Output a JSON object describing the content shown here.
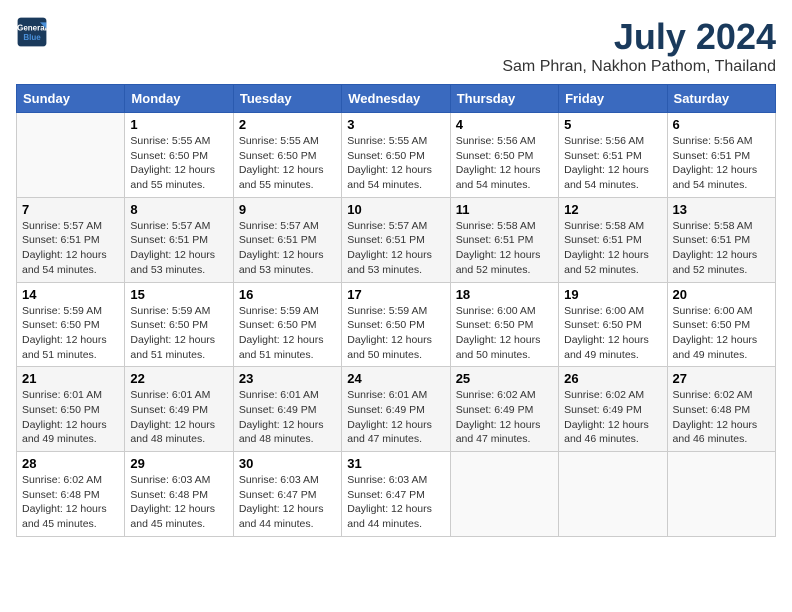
{
  "header": {
    "logo_line1": "General",
    "logo_line2": "Blue",
    "month": "July 2024",
    "location": "Sam Phran, Nakhon Pathom, Thailand"
  },
  "weekdays": [
    "Sunday",
    "Monday",
    "Tuesday",
    "Wednesday",
    "Thursday",
    "Friday",
    "Saturday"
  ],
  "weeks": [
    [
      {
        "day": "",
        "info": ""
      },
      {
        "day": "1",
        "info": "Sunrise: 5:55 AM\nSunset: 6:50 PM\nDaylight: 12 hours\nand 55 minutes."
      },
      {
        "day": "2",
        "info": "Sunrise: 5:55 AM\nSunset: 6:50 PM\nDaylight: 12 hours\nand 55 minutes."
      },
      {
        "day": "3",
        "info": "Sunrise: 5:55 AM\nSunset: 6:50 PM\nDaylight: 12 hours\nand 54 minutes."
      },
      {
        "day": "4",
        "info": "Sunrise: 5:56 AM\nSunset: 6:50 PM\nDaylight: 12 hours\nand 54 minutes."
      },
      {
        "day": "5",
        "info": "Sunrise: 5:56 AM\nSunset: 6:51 PM\nDaylight: 12 hours\nand 54 minutes."
      },
      {
        "day": "6",
        "info": "Sunrise: 5:56 AM\nSunset: 6:51 PM\nDaylight: 12 hours\nand 54 minutes."
      }
    ],
    [
      {
        "day": "7",
        "info": "Sunrise: 5:57 AM\nSunset: 6:51 PM\nDaylight: 12 hours\nand 54 minutes."
      },
      {
        "day": "8",
        "info": "Sunrise: 5:57 AM\nSunset: 6:51 PM\nDaylight: 12 hours\nand 53 minutes."
      },
      {
        "day": "9",
        "info": "Sunrise: 5:57 AM\nSunset: 6:51 PM\nDaylight: 12 hours\nand 53 minutes."
      },
      {
        "day": "10",
        "info": "Sunrise: 5:57 AM\nSunset: 6:51 PM\nDaylight: 12 hours\nand 53 minutes."
      },
      {
        "day": "11",
        "info": "Sunrise: 5:58 AM\nSunset: 6:51 PM\nDaylight: 12 hours\nand 52 minutes."
      },
      {
        "day": "12",
        "info": "Sunrise: 5:58 AM\nSunset: 6:51 PM\nDaylight: 12 hours\nand 52 minutes."
      },
      {
        "day": "13",
        "info": "Sunrise: 5:58 AM\nSunset: 6:51 PM\nDaylight: 12 hours\nand 52 minutes."
      }
    ],
    [
      {
        "day": "14",
        "info": "Sunrise: 5:59 AM\nSunset: 6:50 PM\nDaylight: 12 hours\nand 51 minutes."
      },
      {
        "day": "15",
        "info": "Sunrise: 5:59 AM\nSunset: 6:50 PM\nDaylight: 12 hours\nand 51 minutes."
      },
      {
        "day": "16",
        "info": "Sunrise: 5:59 AM\nSunset: 6:50 PM\nDaylight: 12 hours\nand 51 minutes."
      },
      {
        "day": "17",
        "info": "Sunrise: 5:59 AM\nSunset: 6:50 PM\nDaylight: 12 hours\nand 50 minutes."
      },
      {
        "day": "18",
        "info": "Sunrise: 6:00 AM\nSunset: 6:50 PM\nDaylight: 12 hours\nand 50 minutes."
      },
      {
        "day": "19",
        "info": "Sunrise: 6:00 AM\nSunset: 6:50 PM\nDaylight: 12 hours\nand 49 minutes."
      },
      {
        "day": "20",
        "info": "Sunrise: 6:00 AM\nSunset: 6:50 PM\nDaylight: 12 hours\nand 49 minutes."
      }
    ],
    [
      {
        "day": "21",
        "info": "Sunrise: 6:01 AM\nSunset: 6:50 PM\nDaylight: 12 hours\nand 49 minutes."
      },
      {
        "day": "22",
        "info": "Sunrise: 6:01 AM\nSunset: 6:49 PM\nDaylight: 12 hours\nand 48 minutes."
      },
      {
        "day": "23",
        "info": "Sunrise: 6:01 AM\nSunset: 6:49 PM\nDaylight: 12 hours\nand 48 minutes."
      },
      {
        "day": "24",
        "info": "Sunrise: 6:01 AM\nSunset: 6:49 PM\nDaylight: 12 hours\nand 47 minutes."
      },
      {
        "day": "25",
        "info": "Sunrise: 6:02 AM\nSunset: 6:49 PM\nDaylight: 12 hours\nand 47 minutes."
      },
      {
        "day": "26",
        "info": "Sunrise: 6:02 AM\nSunset: 6:49 PM\nDaylight: 12 hours\nand 46 minutes."
      },
      {
        "day": "27",
        "info": "Sunrise: 6:02 AM\nSunset: 6:48 PM\nDaylight: 12 hours\nand 46 minutes."
      }
    ],
    [
      {
        "day": "28",
        "info": "Sunrise: 6:02 AM\nSunset: 6:48 PM\nDaylight: 12 hours\nand 45 minutes."
      },
      {
        "day": "29",
        "info": "Sunrise: 6:03 AM\nSunset: 6:48 PM\nDaylight: 12 hours\nand 45 minutes."
      },
      {
        "day": "30",
        "info": "Sunrise: 6:03 AM\nSunset: 6:47 PM\nDaylight: 12 hours\nand 44 minutes."
      },
      {
        "day": "31",
        "info": "Sunrise: 6:03 AM\nSunset: 6:47 PM\nDaylight: 12 hours\nand 44 minutes."
      },
      {
        "day": "",
        "info": ""
      },
      {
        "day": "",
        "info": ""
      },
      {
        "day": "",
        "info": ""
      }
    ]
  ]
}
